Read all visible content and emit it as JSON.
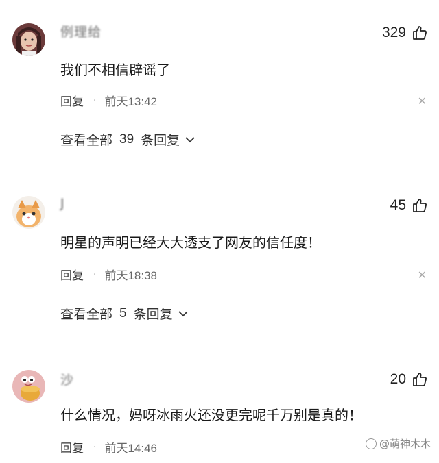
{
  "comments": [
    {
      "username": "例理给",
      "avatar_icon": "girl-portrait-icon",
      "likes": "329",
      "text": "我们不相信辟谣了",
      "reply_label": "回复",
      "time": "前天13:42",
      "view_replies": "查看全部 39 条回复",
      "view_prefix": "查看全部",
      "view_count": "39",
      "view_suffix": "条回复"
    },
    {
      "username": "J",
      "avatar_icon": "cat-avatar-icon",
      "likes": "45",
      "text": "明星的声明已经大大透支了网友的信任度！",
      "reply_label": "回复",
      "time": "前天18:38",
      "view_prefix": "查看全部",
      "view_count": "5",
      "view_suffix": "条回复"
    },
    {
      "username": "沙",
      "avatar_icon": "cartoon-bun-avatar-icon",
      "likes": "20",
      "text": "什么情况，妈呀冰雨火还没更完呢千万别是真的！",
      "reply_label": "回复",
      "time": "前天14:46"
    }
  ],
  "watermark": "@萌神木木",
  "icons": {
    "like": "thumbs-up-icon",
    "close": "close-icon",
    "chevron": "chevron-down-icon"
  }
}
